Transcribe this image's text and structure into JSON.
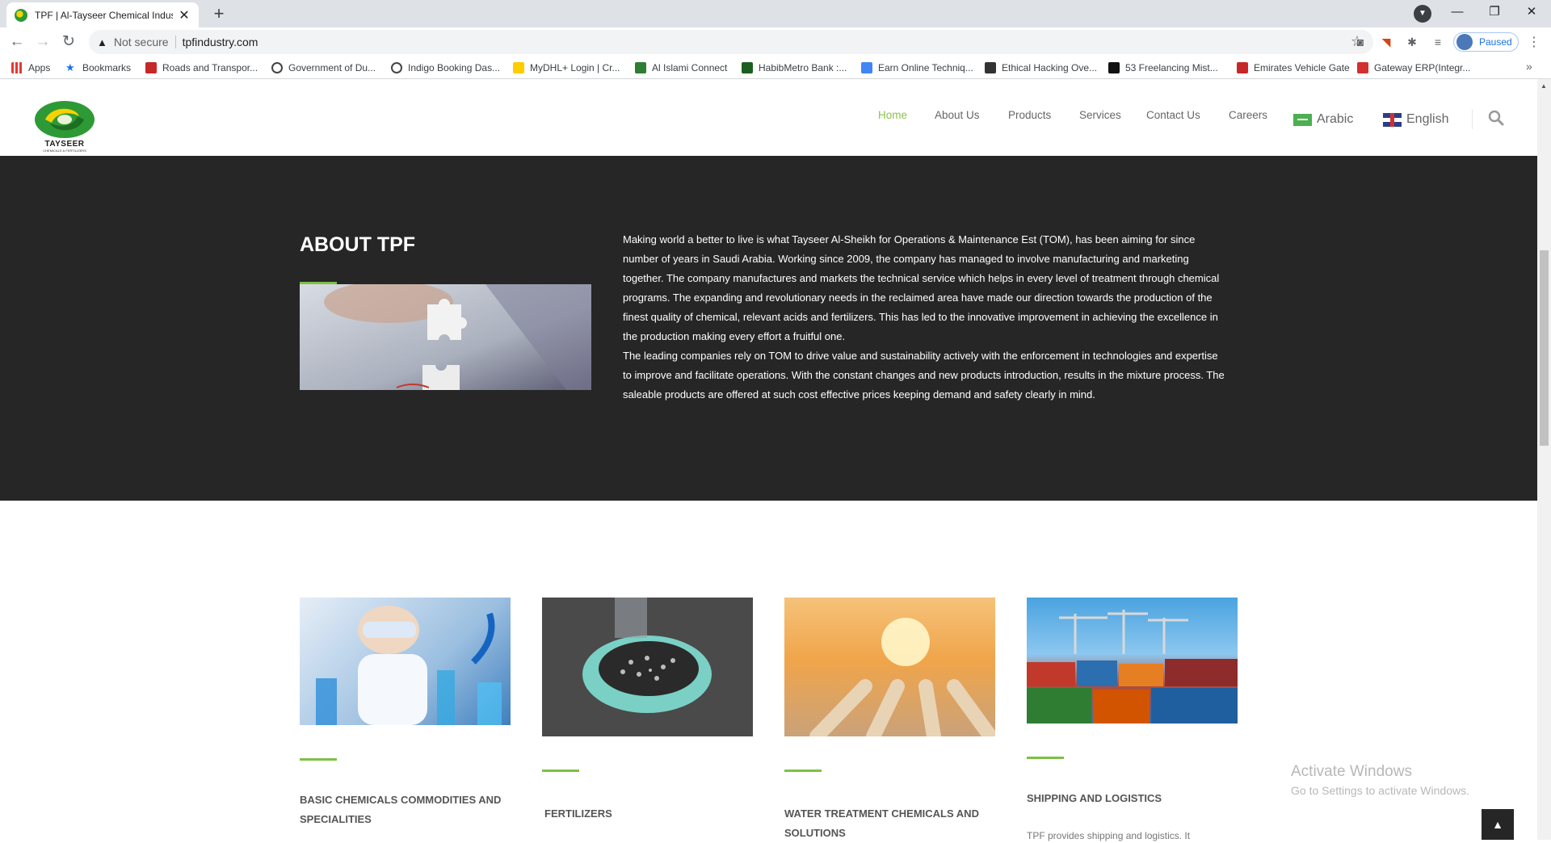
{
  "browser": {
    "tab_title": "TPF | Al-Tayseer Chemical Indust",
    "tab_close": "✕",
    "new_tab": "+",
    "window_controls": {
      "minimize": "—",
      "restore": "❐",
      "close": "✕"
    },
    "security_label": "Not secure",
    "url": "tpfindustry.com",
    "profile_label": "Paused",
    "bookmarks": [
      {
        "label": "Apps",
        "icon": "apps-grid-icon",
        "color": "#e53935"
      },
      {
        "label": "Bookmarks",
        "icon": "star-icon",
        "color": "#1a73e8"
      },
      {
        "label": "Roads and Transpor...",
        "icon": "rta-icon",
        "color": "#c62828"
      },
      {
        "label": "Government of Du...",
        "icon": "globe-icon",
        "color": "#444444"
      },
      {
        "label": "Indigo Booking Das...",
        "icon": "globe-icon",
        "color": "#444444"
      },
      {
        "label": "MyDHL+ Login | Cr...",
        "icon": "dhl-icon",
        "color": "#ffcc00"
      },
      {
        "label": "Al Islami Connect",
        "icon": "al-islami-icon",
        "color": "#2e7d32"
      },
      {
        "label": "HabibMetro Bank :...",
        "icon": "bank-icon",
        "color": "#1b5e20"
      },
      {
        "label": "Earn Online Techniq...",
        "icon": "docs-icon",
        "color": "#4285f4"
      },
      {
        "label": "Ethical Hacking Ove...",
        "icon": "diamond-icon",
        "color": "#333333"
      },
      {
        "label": "53 Freelancing Mist...",
        "icon": "c-icon",
        "color": "#111111"
      },
      {
        "label": "Emirates Vehicle Gate",
        "icon": "evg-icon",
        "color": "#c62828"
      },
      {
        "label": "Gateway ERP(Integr...",
        "icon": "gateway-icon",
        "color": "#d32f2f"
      }
    ],
    "more_bookmarks": "»"
  },
  "site": {
    "logo_text": "TAYSEER",
    "logo_subtext": "CHEMICALS & FERTILIZERS",
    "nav": [
      "Home",
      "About Us",
      "Products",
      "Services",
      "Contact Us",
      "Careers"
    ],
    "active_nav": "Home",
    "lang_arabic": "Arabic",
    "lang_english": "English",
    "accent_color": "#7cc242",
    "about": {
      "title": "ABOUT TPF",
      "paragraph1": "Making world a better to live is what Tayseer Al-Sheikh for Operations & Maintenance Est (TOM), has been aiming for since number of years in Saudi Arabia. Working since 2009, the company has managed to involve manufacturing and marketing together. The company manufactures and markets the technical service which helps in every level of treatment through chemical programs. The expanding and revolutionary needs in the reclaimed area have made our direction towards the production of the finest quality of chemical, relevant acids and fertilizers. This has led to the innovative improvement in achieving the excellence in the production making every effort a fruitful one.",
      "paragraph2": "The leading companies rely on TOM to drive value and sustainability actively with the enforcement in technologies and expertise to improve and facilitate operations. With the constant changes and new products introduction, results in the mixture process. The saleable products are offered at such cost effective prices keeping demand and safety clearly in mind."
    },
    "products": [
      {
        "title": "BASIC CHEMICALS COMMODITIES AND SPECIALITIES"
      },
      {
        "title": "FERTILIZERS"
      },
      {
        "title": "WATER TREATMENT CHEMICALS AND SOLUTIONS"
      },
      {
        "title": "SHIPPING AND LOGISTICS",
        "desc": "TPF provides shipping and logistics. It"
      }
    ],
    "back_to_top": "▲"
  },
  "os_watermark": {
    "title": "Activate Windows",
    "subtitle": "Go to Settings to activate Windows."
  }
}
